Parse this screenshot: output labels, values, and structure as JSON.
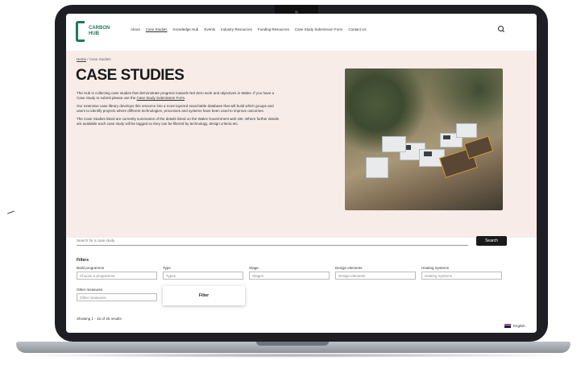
{
  "site": {
    "logo_text": "CARBON HUB",
    "nav": [
      {
        "label": "About"
      },
      {
        "label": "Case Studies",
        "active": true
      },
      {
        "label": "Knowledge Hub"
      },
      {
        "label": "Events"
      },
      {
        "label": "Industry Resources"
      },
      {
        "label": "Funding Resources"
      },
      {
        "label": "Case Study Submission Form"
      },
      {
        "label": "Contact Us"
      }
    ]
  },
  "breadcrumb": {
    "home": "Home",
    "separator": "/",
    "current": "Case Studies"
  },
  "page_title": "CASE STUDIES",
  "intro": [
    {
      "text": "The Hub is collecting case studies that demonstrate progress towards Net Zero work and objectives in Wales. If you have a Case Study to submit please use the ",
      "link": "Case Study Submission Form",
      "after": "."
    },
    {
      "text": "Our extensive case library develops this resource into a more layered searchable database that will build which groups and users to identify projects where different technologies, processes and systems have been used to improve outcomes."
    },
    {
      "text": "The Case Studies listed are currently summaries of the details listed on the Wales Government web site. Where further details are available each case study will be tagged so they can be filtered by technology, design criteria etc."
    }
  ],
  "search": {
    "placeholder": "Search for a case study",
    "button": "Search"
  },
  "filters": {
    "heading": "Filters",
    "fields": [
      {
        "label": "Build programme",
        "value": "Choose a programme"
      },
      {
        "label": "Type",
        "value": "Types"
      },
      {
        "label": "Stage",
        "value": "Stages"
      },
      {
        "label": "Design elements",
        "value": "Design elements"
      },
      {
        "label": "Heating Systems",
        "value": "Heating Systems"
      },
      {
        "label": "Other measures",
        "value": "Other measures"
      }
    ],
    "apply": "Filter"
  },
  "results": {
    "text": "Showing 1 - 15 of 46 results"
  },
  "language": {
    "label": "English"
  },
  "colors": {
    "hero_bg": "#f7ece8",
    "accent": "#1c7a5c",
    "button": "#1a1a1a"
  }
}
